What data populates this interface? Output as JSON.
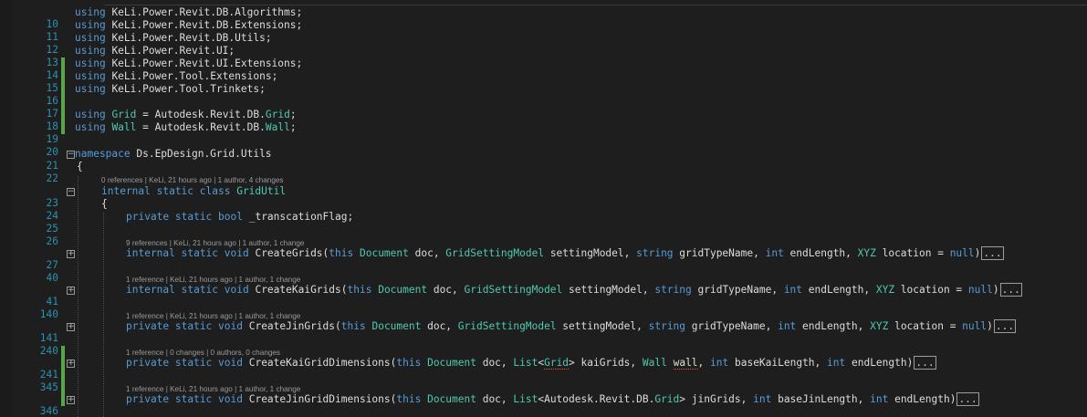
{
  "editor": {
    "usings": [
      {
        "ln": "10",
        "ns": "KeLi.Power.Revit.DB.Algorithms"
      },
      {
        "ln": "11",
        "ns": "KeLi.Power.Revit.DB.Extensions"
      },
      {
        "ln": "12",
        "ns": "KeLi.Power.Revit.DB.Utils"
      },
      {
        "ln": "13",
        "ns": "KeLi.Power.Revit.UI"
      },
      {
        "ln": "14",
        "ns": "KeLi.Power.Revit.UI.Extensions"
      },
      {
        "ln": "15",
        "ns": "KeLi.Power.Tool.Extensions"
      },
      {
        "ln": "16",
        "ns": "KeLi.Power.Tool.Trinkets"
      }
    ],
    "blank1_ln": "17",
    "alias_grid": {
      "ln": "18",
      "kw": "using",
      "alias": "Grid",
      "eq": " = ",
      "prefix": "Autodesk.Revit.DB.",
      "type": "Grid",
      "end": ";"
    },
    "alias_wall": {
      "ln": "19",
      "kw": "using",
      "alias": "Wall",
      "eq": " = ",
      "prefix": "Autodesk.Revit.DB.",
      "type": "Wall",
      "end": ";"
    },
    "blank2_ln": "20",
    "ns_line": {
      "ln": "21",
      "kw": "namespace",
      "name": " Ds.EpDesign.Grid.Utils"
    },
    "brace1": {
      "ln": "22",
      "text": "{"
    },
    "class_lens": "0 references | KeLi, 21 hours ago | 1 author, 4 changes",
    "class_line": {
      "ln": "23",
      "kw": "internal static class",
      "name": "GridUtil"
    },
    "brace2": {
      "ln": "24",
      "text": "{"
    },
    "field_line": {
      "ln": "25",
      "kw": "private static bool",
      "name": " _transcationFlag;"
    },
    "blank3_ln": "26",
    "methods": [
      {
        "lens": "9 references | KeLi, 21 hours ago | 1 author, 1 change",
        "ln": "27",
        "next_ln": "40",
        "access": "internal static void",
        "name": " CreateGrids(",
        "this": "this",
        "doc_type": "Document",
        "a1": " doc, ",
        "t2": "GridSettingModel",
        "a2": " settingModel, ",
        "kw3": "string",
        "a3": " gridTypeName, ",
        "kw4": "int",
        "a4": " endLength, ",
        "t5": "XYZ",
        "a5": " location = ",
        "kw6": "null",
        "close": ")",
        "fold": "..."
      },
      {
        "lens": "1 reference | KeLi, 21 hours ago | 1 author, 1 change",
        "ln": "41",
        "next_ln": "140",
        "access": "internal static void",
        "name": " CreateKaiGrids(",
        "this": "this",
        "doc_type": "Document",
        "a1": " doc, ",
        "t2": "GridSettingModel",
        "a2": " settingModel, ",
        "kw3": "string",
        "a3": " gridTypeName, ",
        "kw4": "int",
        "a4": " endLength, ",
        "t5": "XYZ",
        "a5": " location = ",
        "kw6": "null",
        "close": ")",
        "fold": "..."
      },
      {
        "lens": "1 reference | KeLi, 21 hours ago | 1 author, 1 change",
        "ln": "141",
        "next_ln": "240",
        "access": "private static void",
        "name": " CreateJinGrids(",
        "this": "this",
        "doc_type": "Document",
        "a1": " doc, ",
        "t2": "GridSettingModel",
        "a2": " settingModel, ",
        "kw3": "string",
        "a3": " gridTypeName, ",
        "kw4": "int",
        "a4": " endLength, ",
        "t5": "XYZ",
        "a5": " location = ",
        "kw6": "null",
        "close": ")",
        "fold": "..."
      }
    ],
    "dim_kai": {
      "lens": "1 reference | 0 changes | 0 authors, 0 changes",
      "ln": "241",
      "next_ln": "345",
      "access": "private static void",
      "name": " CreateKaiGridDimensions(",
      "this": "this",
      "doc_type": "Document",
      "a1": " doc, ",
      "list": "List",
      "lt": "<",
      "grid": "Grid",
      "gt": ">",
      "a2": " kaiGrids, ",
      "wall": "Wall",
      "sp": " ",
      "wall_name": "wall",
      "a3": ", ",
      "kw4": "int",
      "a4": " baseKaiLength, ",
      "kw5": "int",
      "a5": " endLength)",
      "fold": "..."
    },
    "dim_jin": {
      "lens": "1 reference | KeLi, 21 hours ago | 1 author, 1 change",
      "ln": "346",
      "next_ln": "428",
      "access": "private static void",
      "name": " CreateJinGridDimensions(",
      "this": "this",
      "doc_type": "Document",
      "a1": " doc, ",
      "list": "List",
      "inner": "<Autodesk.Revit.DB.",
      "grid": "Grid",
      "gt": ">",
      "a2": " jinGrids, ",
      "kw3": "int",
      "a3": " baseJinLength, ",
      "kw4": "int",
      "a4": " endLength)",
      "fold": "..."
    },
    "colors": {
      "keyword": "#569cd6",
      "type": "#4ec9b0",
      "line_number": "#2b91af",
      "change_bar": "#57a64a",
      "background": "#1e1e1e"
    }
  }
}
